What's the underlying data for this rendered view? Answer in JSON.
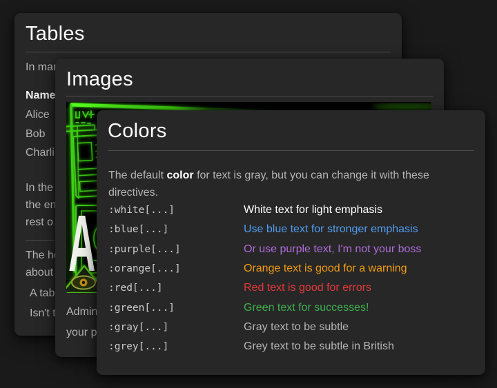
{
  "page": {
    "background_color": "#1a1a1a",
    "card_color": "#272727"
  },
  "tables_window": {
    "title": "Tables",
    "intro_fragment": "In mar",
    "table": {
      "header_fragment": "Name",
      "row_fragments": [
        "Alice",
        "Bob",
        "Charli"
      ]
    },
    "paragraph2_lines": [
      "In the",
      "the en",
      "rest o"
    ],
    "paragraph3_lines": [
      "The he",
      "about"
    ],
    "quote_lines": [
      "A tabl",
      "Isn't t"
    ]
  },
  "images_window": {
    "title": "Images",
    "artwork": {
      "description": "black image with neon green alien ID-card illustration",
      "big_letter": "A"
    },
    "caption_lines": [
      "Admin",
      "your p"
    ]
  },
  "colors_window": {
    "title": "Colors",
    "intro": {
      "before_bold": "The default ",
      "bold_word": "color",
      "after_bold": " for text is gray, but you can change it with these directives."
    },
    "directives": [
      {
        "code": ":white[...]",
        "description": "White text for light emphasis",
        "color": "#ffffff",
        "css": "color:#ffffff;font-weight:500"
      },
      {
        "code": ":blue[...]",
        "description": "Use blue text for stronger emphasis",
        "color": "#4f9cf0",
        "css": "color:#4f9cf0"
      },
      {
        "code": ":purple[...]",
        "description": "Or use purple text, I'm not your boss",
        "color": "#b06cd8",
        "css": "color:#b06cd8"
      },
      {
        "code": ":orange[...]",
        "description": "Orange text is good for a warning",
        "color": "#f39c12",
        "css": "color:#f39c12"
      },
      {
        "code": ":red[...]",
        "description": "Red text is good for errors",
        "color": "#e5393b",
        "css": "color:#e5393b"
      },
      {
        "code": ":green[...]",
        "description": "Green text for successes!",
        "color": "#3fb150",
        "css": "color:#3fb150"
      },
      {
        "code": ":gray[...]",
        "description": "Gray text to be subtle",
        "color": "#b5b5b5",
        "css": "color:#b5b5b5"
      },
      {
        "code": ":grey[...]",
        "description": "Grey text to be subtle in British",
        "color": "#b5b5b5",
        "css": "color:#b5b5b5"
      }
    ]
  }
}
